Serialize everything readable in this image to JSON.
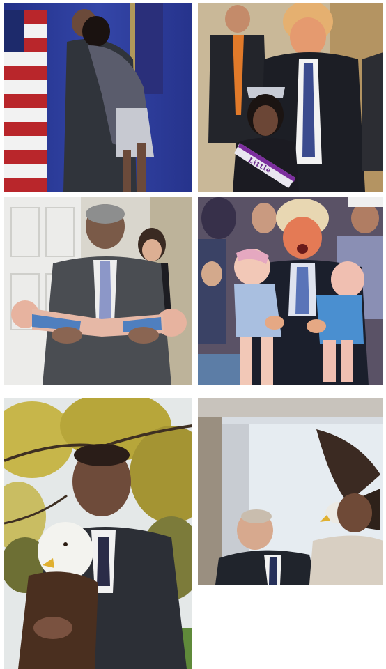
{
  "photos": [
    {
      "name": "hug-photo"
    },
    {
      "name": "pageant-girl-photo"
    },
    {
      "name": "two-babies-calm-photo"
    },
    {
      "name": "two-babies-crying-photo"
    },
    {
      "name": "eagle-posing-photo"
    },
    {
      "name": "eagle-attack-photo"
    }
  ],
  "sash_text": "Little",
  "colors": {
    "stage_blue": "#2d3c9a",
    "suit_gray": "#3b3f46",
    "sky": "#dfe6ee",
    "foliage": "#b7a63a",
    "sash_purple": "#7c2e9e"
  }
}
